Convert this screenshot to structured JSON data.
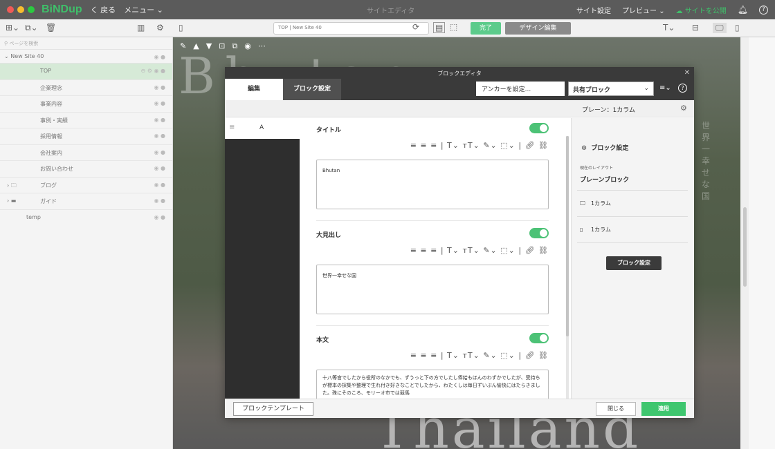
{
  "app": {
    "brand": "BiNDup",
    "back": "く 戻る",
    "menu": "メニュー",
    "title": "サイトエディタ",
    "site_settings": "サイト設定",
    "preview": "プレビュー",
    "publish": "サイトを公開"
  },
  "toolbar": {
    "url": "TOP | New Site 40",
    "done": "完了",
    "design_edit": "デザイン編集"
  },
  "sidebar": {
    "search_placeholder": "ページを検索",
    "site_name": "New Site 40",
    "pages": [
      {
        "label": "TOP",
        "active": true
      },
      {
        "label": "企業理念"
      },
      {
        "label": "事業内容"
      },
      {
        "label": "事例・実績"
      },
      {
        "label": "採用情報"
      },
      {
        "label": "会社案内"
      },
      {
        "label": "お問い合わせ"
      },
      {
        "label": "ブログ",
        "folder": true
      },
      {
        "label": "ガイド",
        "folder": true
      },
      {
        "label": "temp"
      }
    ]
  },
  "canvas": {
    "heading_text": "Bhutan",
    "side_text": "世界一幸せな国",
    "bottom_text": "Thailand"
  },
  "modal": {
    "title": "ブロックエディタ",
    "tabs": [
      "編集",
      "ブロック設定"
    ],
    "anchor_placeholder": "アンカーを設定...",
    "shared_block": "共有ブロック",
    "plain_label": "プレーン：1カラム",
    "column_label": "A",
    "fields": [
      {
        "label": "タイトル",
        "value": "Bhutan"
      },
      {
        "label": "大見出し",
        "value": "世界一幸せな国"
      },
      {
        "label": "本文",
        "value": "十八等官でしたから役所のなかでも、ずうっと下の方でしたし俸給もほんのわずかでしたが、受持ちが標本の採集や整理で生れ付き好きなことでしたから、わたくしは毎日ずいぶん愉快にはたらきました。殊にそのころ、モリーオ市では競馬"
      }
    ],
    "panel": {
      "title": "ブロック設定",
      "current_layout_label": "現在のレイアウト",
      "current_layout": "プレーンブロック",
      "options": [
        {
          "icon": "desktop-icon",
          "label": "1カラム"
        },
        {
          "icon": "mobile-icon",
          "label": "1カラム"
        }
      ],
      "button": "ブロック設定"
    },
    "footer": {
      "template": "ブロックテンプレート",
      "close": "閉じる",
      "apply": "適用"
    }
  },
  "colors": {
    "accent": "#3fc66f",
    "topbar": "#5b5b5b",
    "modal_header": "#3a3a3a"
  }
}
